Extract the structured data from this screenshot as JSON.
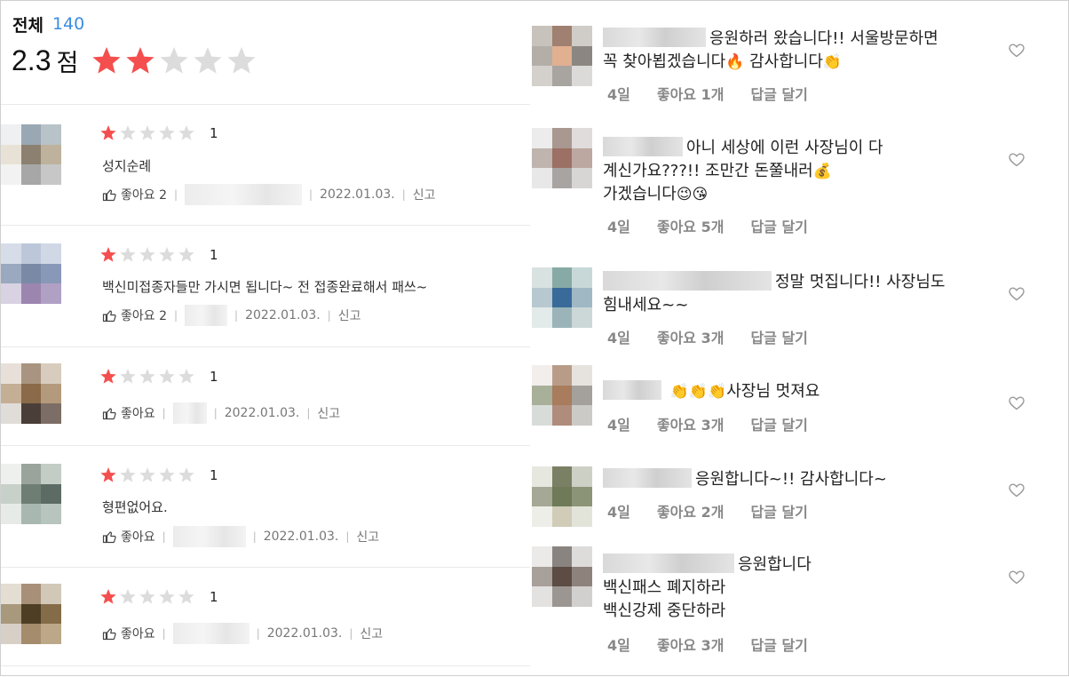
{
  "summary": {
    "total_label": "전체",
    "total_count": "140",
    "score": "2.3",
    "score_unit": "점",
    "rating": 2.3,
    "max_rating": 5
  },
  "reviews": [
    {
      "rating": 1,
      "rating_label": "1",
      "text": "성지순례",
      "like_label": "좋아요 2",
      "date": "2022.01.03.",
      "report": "신고"
    },
    {
      "rating": 1,
      "rating_label": "1",
      "text": "백신미접종자들만 가시면 됩니다~ 전 접종완료해서 패쓰~",
      "like_label": "좋아요 2",
      "date": "2022.01.03.",
      "report": "신고"
    },
    {
      "rating": 1,
      "rating_label": "1",
      "text": "",
      "like_label": "좋아요",
      "date": "2022.01.03.",
      "report": "신고"
    },
    {
      "rating": 1,
      "rating_label": "1",
      "text": "형편없어요.",
      "like_label": "좋아요",
      "date": "2022.01.03.",
      "report": "신고"
    },
    {
      "rating": 1,
      "rating_label": "1",
      "text": "",
      "like_label": "좋아요",
      "date": "2022.01.03.",
      "report": "신고"
    }
  ],
  "comments": [
    {
      "lines": [
        "응원하러 왔습니다!! 서울방문하면",
        "꼭 찾아뵙겠습니다",
        "감사합니다"
      ],
      "emojis": [
        "🔥",
        "👏"
      ],
      "time": "4일",
      "likes": "좋아요 1개",
      "reply": "답글 달기"
    },
    {
      "lines": [
        "아니 세상에 이런 사장님이 다",
        "계신가요???!! 조만간 돈쭐내러",
        "가겠습니다"
      ],
      "emojis": [
        "💰",
        "😉😘"
      ],
      "time": "4일",
      "likes": "좋아요 5개",
      "reply": "답글 달기"
    },
    {
      "lines": [
        "정말 멋집니다!! 사장님도",
        "힘내세요~~"
      ],
      "emojis": [],
      "time": "4일",
      "likes": "좋아요 3개",
      "reply": "답글 달기"
    },
    {
      "lines": [
        "사장님 멋져요"
      ],
      "emojis": [
        "👏👏👏"
      ],
      "time": "4일",
      "likes": "좋아요 3개",
      "reply": "답글 달기"
    },
    {
      "lines": [
        "응원합니다~!! 감사합니다~"
      ],
      "emojis": [],
      "time": "4일",
      "likes": "좋아요 2개",
      "reply": "답글 달기"
    },
    {
      "lines": [
        "응원합니다",
        "백신패스 폐지하라",
        "백신강제 중단하라"
      ],
      "emojis": [],
      "time": "4일",
      "likes": "좋아요 3개",
      "reply": "답글 달기"
    }
  ],
  "colors": {
    "star_on": "#f54e4e",
    "star_off": "#dcdcdc",
    "link_blue": "#3b8de0",
    "meta_gray": "#888888"
  }
}
